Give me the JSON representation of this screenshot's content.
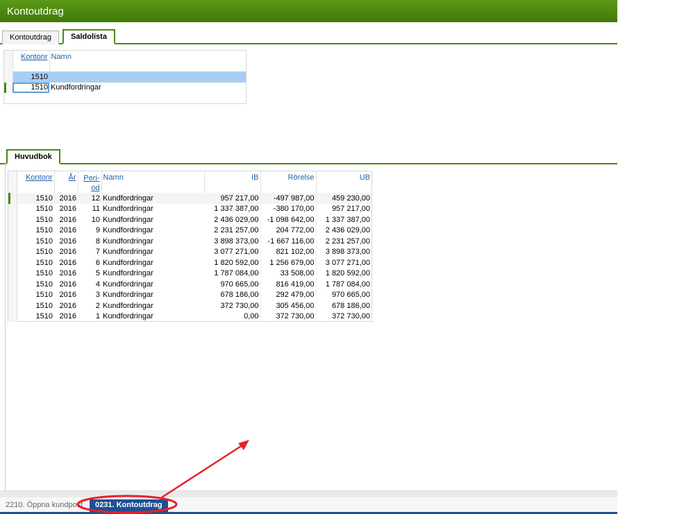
{
  "window": {
    "title": "Kontoutdrag"
  },
  "tabs": [
    {
      "label": "Kontoutdrag",
      "active": false
    },
    {
      "label": "Saldolista",
      "active": true
    }
  ],
  "saldolista": {
    "columns": [
      "Kontonr",
      "Namn"
    ],
    "rows": [
      {
        "kontonr": "1510",
        "namn": ""
      },
      {
        "kontonr": "1510",
        "namn": "Kundfordringar"
      }
    ]
  },
  "huvudbok": {
    "tab_label": "Huvudbok",
    "columns": {
      "kontonr": "Kontonr",
      "ar": "År",
      "period_1": "Peri-",
      "period_2": "od",
      "namn": "Namn",
      "ib": "IB",
      "rorelse": "Rörelse",
      "ub": "UB"
    },
    "rows": [
      [
        "1510",
        "2016",
        "12",
        "Kundfordringar",
        "957 217,00",
        "-497 987,00",
        "459 230,00"
      ],
      [
        "1510",
        "2016",
        "11",
        "Kundfordringar",
        "1 337 387,00",
        "-380 170,00",
        "957 217,00"
      ],
      [
        "1510",
        "2016",
        "10",
        "Kundfordringar",
        "2 436 029,00",
        "-1 098 642,00",
        "1 337 387,00"
      ],
      [
        "1510",
        "2016",
        "9",
        "Kundfordringar",
        "2 231 257,00",
        "204 772,00",
        "2 436 029,00"
      ],
      [
        "1510",
        "2016",
        "8",
        "Kundfordringar",
        "3 898 373,00",
        "-1 667 116,00",
        "2 231 257,00"
      ],
      [
        "1510",
        "2016",
        "7",
        "Kundfordringar",
        "3 077 271,00",
        "821 102,00",
        "3 898 373,00"
      ],
      [
        "1510",
        "2016",
        "6",
        "Kundfordringar",
        "1 820 592,00",
        "1 256 679,00",
        "3 077 271,00"
      ],
      [
        "1510",
        "2016",
        "5",
        "Kundfordringar",
        "1 787 084,00",
        "33 508,00",
        "1 820 592,00"
      ],
      [
        "1510",
        "2016",
        "4",
        "Kundfordringar",
        "970 665,00",
        "816 419,00",
        "1 787 084,00"
      ],
      [
        "1510",
        "2016",
        "3",
        "Kundfordringar",
        "678 186,00",
        "292 479,00",
        "970 665,00"
      ],
      [
        "1510",
        "2016",
        "2",
        "Kundfordringar",
        "372 730,00",
        "305 456,00",
        "678 186,00"
      ],
      [
        "1510",
        "2016",
        "1",
        "Kundfordringar",
        "0,00",
        "372 730,00",
        "372 730,00"
      ]
    ]
  },
  "statusbar": {
    "inactive_item": "2210. Öppna kundpost",
    "active_item": "0231. Kontoutdrag"
  },
  "colors": {
    "titlebar": "#4a8a10",
    "selection": "#a9cdf2",
    "status_active": "#1f4f93",
    "annotation": "#e8202a"
  }
}
